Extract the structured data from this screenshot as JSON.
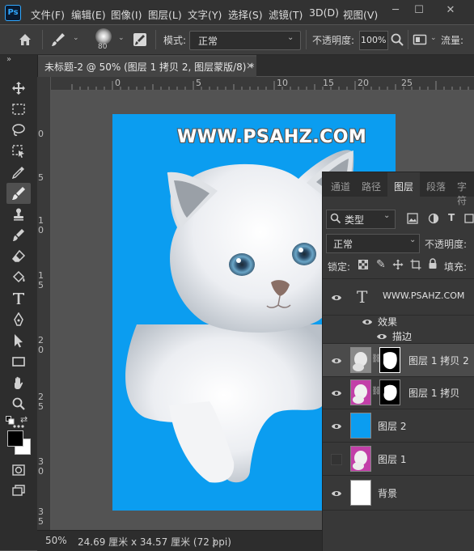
{
  "app": {
    "logo_text": "Ps"
  },
  "menu": [
    "文件(F)",
    "编辑(E)",
    "图像(I)",
    "图层(L)",
    "文字(Y)",
    "选择(S)",
    "滤镜(T)",
    "3D(D)",
    "视图(V)"
  ],
  "options": {
    "brush_size": "80",
    "mode_label": "模式:",
    "mode_value": "正常",
    "opacity_label": "不透明度:",
    "opacity_value": "100%",
    "flow_label": "流量:"
  },
  "document_tab": {
    "title": "未标题-2 @ 50% (图层 1 拷贝 2, 图层蒙版/8) *",
    "close": "×"
  },
  "rulers": {
    "horizontal": [
      "0",
      "5",
      "10",
      "15",
      "20",
      "25"
    ],
    "vertical": [
      "0",
      "5",
      "1\n0",
      "1\n5",
      "2\n0",
      "2\n5",
      "3\n0",
      "3\n5"
    ]
  },
  "canvas": {
    "watermark": "WWW.PSAHZ.COM",
    "background_color": "#0b9df0"
  },
  "status": {
    "zoom": "50%",
    "doc_info": "24.69 厘米 x 34.57 厘米 (72 ppi)",
    "arrow": "〉"
  },
  "layers_panel": {
    "tabs": [
      "通道",
      "路径",
      "图层",
      "段落",
      "字符"
    ],
    "active_tab": "图层",
    "filter_kind": "类型",
    "blend_mode": "正常",
    "opacity_label": "不透明度:",
    "lock_label": "锁定:",
    "fill_label": "填充:",
    "layers": [
      {
        "name": "WWW.PSAHZ.COM",
        "type": "text",
        "visible": true
      },
      {
        "name": "效果",
        "type": "effects-header",
        "visible": true
      },
      {
        "name": "描边",
        "type": "effect",
        "visible": true
      },
      {
        "name": "图层 1 拷贝 2",
        "type": "masked",
        "visible": true,
        "selected": true
      },
      {
        "name": "图层 1 拷贝",
        "type": "masked",
        "visible": true
      },
      {
        "name": "图层 2",
        "type": "fill",
        "visible": true,
        "color": "#0b9df0"
      },
      {
        "name": "图层 1",
        "type": "image",
        "visible": false
      },
      {
        "name": "背景",
        "type": "background",
        "visible": true
      }
    ]
  }
}
